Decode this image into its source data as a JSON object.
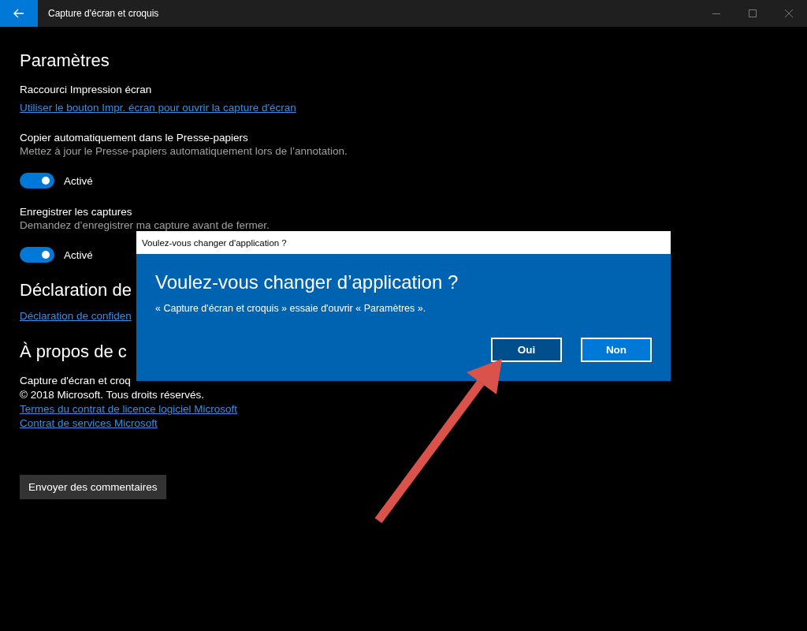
{
  "window": {
    "title": "Capture d'écran et croquis"
  },
  "settings": {
    "heading": "Paramètres",
    "sections": [
      {
        "kind": "link",
        "label": "Raccourci Impression écran",
        "link": "Utiliser le bouton Impr. écran pour ouvrir la capture d'écran"
      },
      {
        "kind": "toggle",
        "label": "Copier automatiquement dans le Presse-papiers",
        "description": "Mettez à jour le Presse-papiers automatiquement lors de l’annotation.",
        "on": true,
        "state_text": "Activé"
      },
      {
        "kind": "toggle",
        "label": "Enregistrer les captures",
        "description": "Demandez d’enregistrer ma capture avant de fermer.",
        "on": true,
        "state_text": "Activé"
      }
    ]
  },
  "privacy": {
    "heading": "Déclaration de",
    "link": "Déclaration de confiden"
  },
  "about": {
    "heading": "À propos de c",
    "lines": [
      "Capture d'écran et croq",
      "© 2018 Microsoft. Tous droits réservés."
    ],
    "links": [
      "Termes du contrat de licence logiciel Microsoft",
      "Contrat de services Microsoft"
    ]
  },
  "feedback_button": "Envoyer des commentaires",
  "dialog": {
    "title": "Voulez-vous changer d'application ?",
    "heading": "Voulez-vous changer d’application ?",
    "message": "« Capture d'écran et croquis » essaie d'ouvrir « Paramètres ».",
    "buttons": [
      {
        "label": "Oui",
        "selected": true
      },
      {
        "label": "Non",
        "selected": false
      }
    ]
  }
}
